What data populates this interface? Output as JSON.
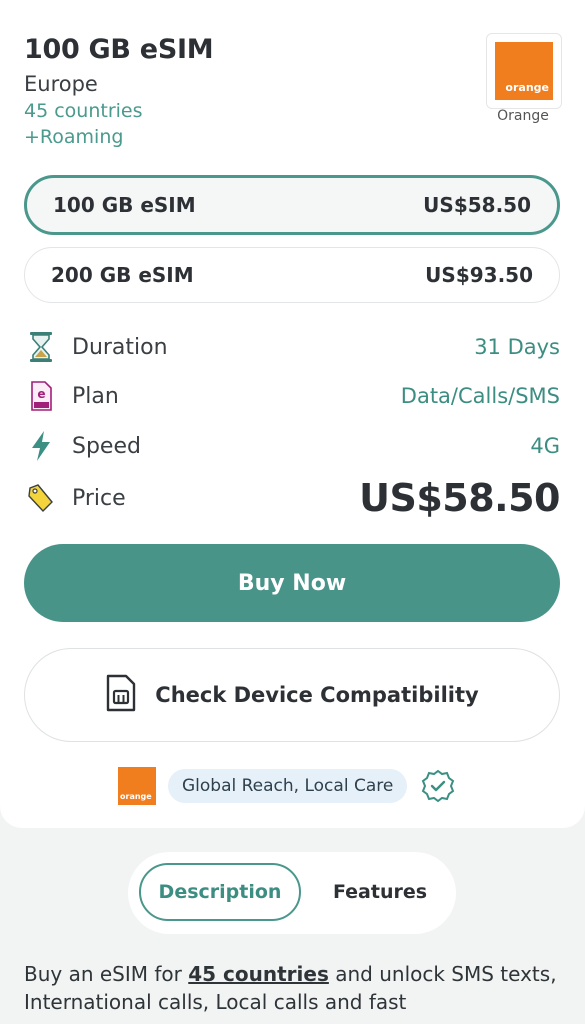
{
  "header": {
    "title": "100 GB eSIM",
    "region": "Europe",
    "countries": "45 countries",
    "roaming": "+Roaming",
    "carrier_logo_text": "orange",
    "carrier_name": "Orange"
  },
  "plans": [
    {
      "name": "100 GB eSIM",
      "price": "US$58.50",
      "selected": true
    },
    {
      "name": "200 GB eSIM",
      "price": "US$93.50",
      "selected": false
    }
  ],
  "details": {
    "duration": {
      "label": "Duration",
      "value": "31 Days"
    },
    "plan": {
      "label": "Plan",
      "value": "Data/Calls/SMS"
    },
    "speed": {
      "label": "Speed",
      "value": "4G"
    },
    "price": {
      "label": "Price",
      "value": "US$58.50"
    }
  },
  "actions": {
    "buy_label": "Buy Now",
    "compat_label": "Check Device Compatibility"
  },
  "care": {
    "logo_text": "orange",
    "badge": "Global Reach, Local Care"
  },
  "tabs": [
    {
      "label": "Description",
      "active": true
    },
    {
      "label": "Features",
      "active": false
    }
  ],
  "description": {
    "pre": "Buy an eSIM for ",
    "link": "45 countries",
    "post": " and unlock SMS texts, International calls, Local calls and fast"
  },
  "colors": {
    "accent": "#489489",
    "carrier_orange": "#f07d1e",
    "value_text": "#3c8d82",
    "badge_bg": "#e6f0f8"
  }
}
